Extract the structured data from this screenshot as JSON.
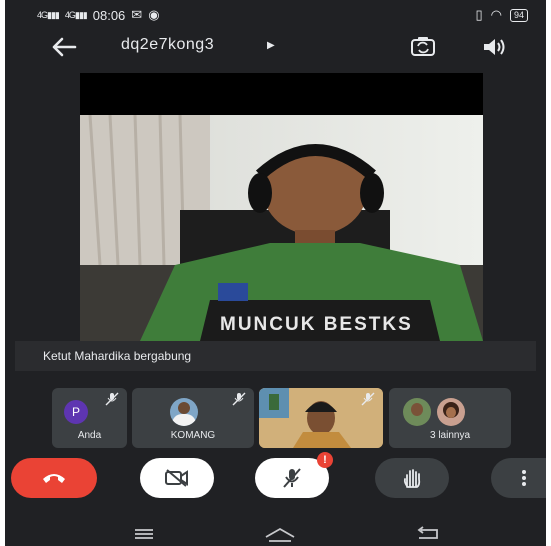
{
  "status_bar": {
    "signal_1": "4G",
    "signal_2": "4G",
    "time": "08:06",
    "battery": "94"
  },
  "header": {
    "meeting_code": "dq2e7kong3"
  },
  "main_video": {
    "shirt_text": "MUNCUK BESTKS"
  },
  "notification": {
    "text": "Ketut Mahardika bergabung"
  },
  "participants": [
    {
      "name": "Anda",
      "avatar_letter": "P",
      "muted": true
    },
    {
      "name": "KOMANG",
      "muted": true
    },
    {
      "name": "",
      "muted": true
    },
    {
      "name": "3 lainnya",
      "muted": true
    }
  ],
  "controls": {
    "end_call": "end-call",
    "camera_off": "camera-off",
    "mic_off": "mic-off",
    "raise_hand": "raise-hand",
    "more": "more-options",
    "mic_alert_badge": "!"
  },
  "colors": {
    "background": "#202124",
    "end_call": "#ea4335",
    "tile": "#3c4043",
    "badge": "#ea4335"
  }
}
